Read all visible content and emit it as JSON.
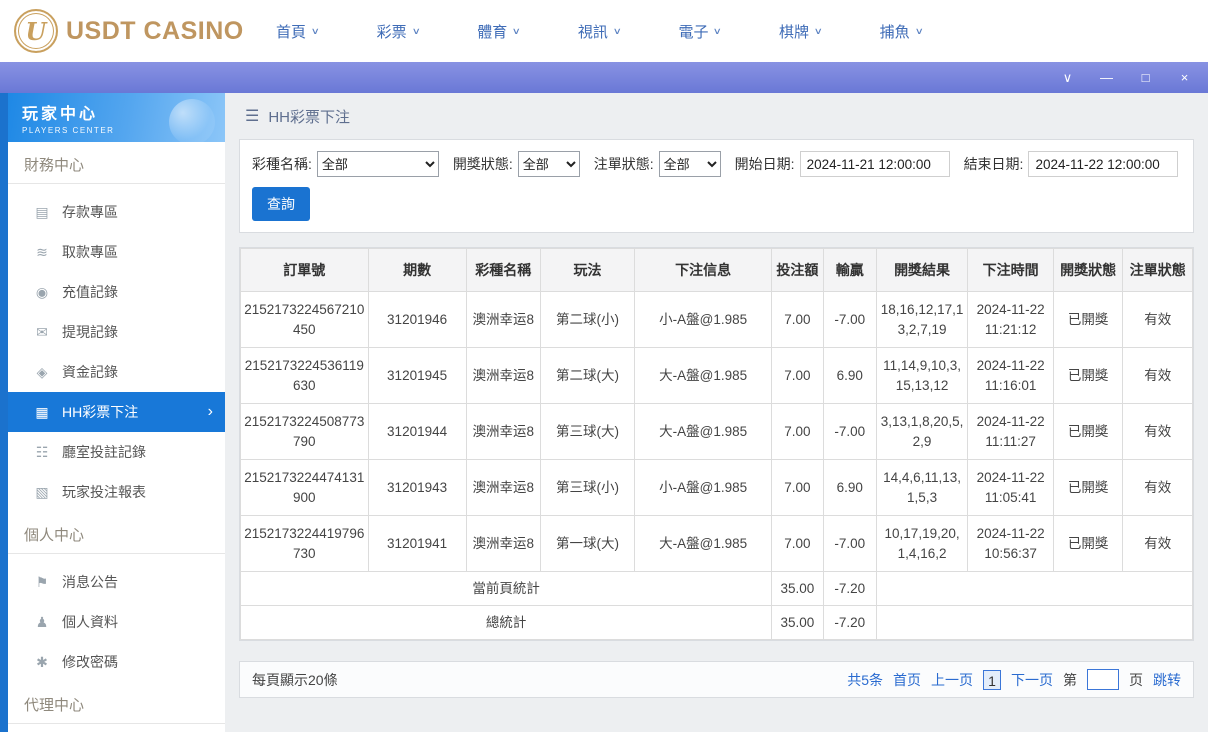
{
  "colors": {
    "accent_blue": "#1878d8",
    "link_blue": "#2a6bd0",
    "gold": "#bf9660",
    "titlebar_purple": "#7280da",
    "sidebar_strip": "#1b72cd"
  },
  "icons": {
    "menu": "☰",
    "caret_down": "∨",
    "chevron_right": "›"
  },
  "header": {
    "logo_letter": "U",
    "logo_text": "USDT CASINO",
    "nav": [
      {
        "label": "首頁"
      },
      {
        "label": "彩票"
      },
      {
        "label": "體育"
      },
      {
        "label": "視訊"
      },
      {
        "label": "電子"
      },
      {
        "label": "棋牌"
      },
      {
        "label": "捕魚"
      }
    ]
  },
  "titlebar": {
    "controls": {
      "collapse": "∨",
      "minimize": "—",
      "maximize": "□",
      "close": "×"
    }
  },
  "sidebar": {
    "title": "玩家中心",
    "subtitle": "PLAYERS CENTER",
    "sections": [
      {
        "label": "財務中心",
        "items": [
          {
            "label": "存款專區",
            "glyph": "▤"
          },
          {
            "label": "取款專區",
            "glyph": "≋"
          },
          {
            "label": "充值記錄",
            "glyph": "◉"
          },
          {
            "label": "提現記錄",
            "glyph": "✉"
          },
          {
            "label": "資金記錄",
            "glyph": "◈"
          },
          {
            "label": "HH彩票下注",
            "glyph": "▦",
            "active": true
          },
          {
            "label": "廳室投註記錄",
            "glyph": "☷"
          },
          {
            "label": "玩家投注報表",
            "glyph": "▧"
          }
        ]
      },
      {
        "label": "個人中心",
        "items": [
          {
            "label": "消息公告",
            "glyph": "⚑"
          },
          {
            "label": "個人資料",
            "glyph": "♟"
          },
          {
            "label": "修改密碼",
            "glyph": "✱"
          }
        ]
      },
      {
        "label": "代理中心",
        "items": []
      }
    ]
  },
  "breadcrumb": {
    "title": "HH彩票下注"
  },
  "filters": {
    "lottery_label": "彩種名稱:",
    "lottery_value": "全部",
    "draw_status_label": "開獎狀態:",
    "draw_status_value": "全部",
    "order_status_label": "注單狀態:",
    "order_status_value": "全部",
    "start_label": "開始日期:",
    "start_value": "2024-11-21 12:00:00",
    "end_label": "結束日期:",
    "end_value": "2024-11-22 12:00:00",
    "search_label": "查詢"
  },
  "table": {
    "headers": [
      "訂單號",
      "期數",
      "彩種名稱",
      "玩法",
      "下注信息",
      "投注額",
      "輸贏",
      "開獎結果",
      "下注時間",
      "開獎狀態",
      "注單狀態"
    ],
    "rows": [
      {
        "order": "2152173224567210450",
        "period": "31201946",
        "lottery": "澳洲幸运8",
        "play": "第二球(小)",
        "info": "小-A盤@1.985",
        "bet": "7.00",
        "winloss": "-7.00",
        "result": "18,16,12,17,13,2,7,19",
        "time": "2024-11-22 11:21:12",
        "draw": "已開獎",
        "status": "有效"
      },
      {
        "order": "2152173224536119630",
        "period": "31201945",
        "lottery": "澳洲幸运8",
        "play": "第二球(大)",
        "info": "大-A盤@1.985",
        "bet": "7.00",
        "winloss": "6.90",
        "result": "11,14,9,10,3,15,13,12",
        "time": "2024-11-22 11:16:01",
        "draw": "已開獎",
        "status": "有效"
      },
      {
        "order": "2152173224508773790",
        "period": "31201944",
        "lottery": "澳洲幸运8",
        "play": "第三球(大)",
        "info": "大-A盤@1.985",
        "bet": "7.00",
        "winloss": "-7.00",
        "result": "3,13,1,8,20,5,2,9",
        "time": "2024-11-22 11:11:27",
        "draw": "已開獎",
        "status": "有效"
      },
      {
        "order": "2152173224474131900",
        "period": "31201943",
        "lottery": "澳洲幸运8",
        "play": "第三球(小)",
        "info": "小-A盤@1.985",
        "bet": "7.00",
        "winloss": "6.90",
        "result": "14,4,6,11,13,1,5,3",
        "time": "2024-11-22 11:05:41",
        "draw": "已開獎",
        "status": "有效"
      },
      {
        "order": "2152173224419796730",
        "period": "31201941",
        "lottery": "澳洲幸运8",
        "play": "第一球(大)",
        "info": "大-A盤@1.985",
        "bet": "7.00",
        "winloss": "-7.00",
        "result": "10,17,19,20,1,4,16,2",
        "time": "2024-11-22 10:56:37",
        "draw": "已開獎",
        "status": "有效"
      }
    ],
    "summary": [
      {
        "label": "當前頁統計",
        "bet": "35.00",
        "winloss": "-7.20"
      },
      {
        "label": "總統計",
        "bet": "35.00",
        "winloss": "-7.20"
      }
    ]
  },
  "footer": {
    "per_page": "每頁顯示20條",
    "total": "共5条",
    "first": "首页",
    "prev": "上一页",
    "current": "1",
    "next": "下一页",
    "jump_prefix": "第",
    "jump_suffix": "页",
    "jump_label": "跳转"
  }
}
